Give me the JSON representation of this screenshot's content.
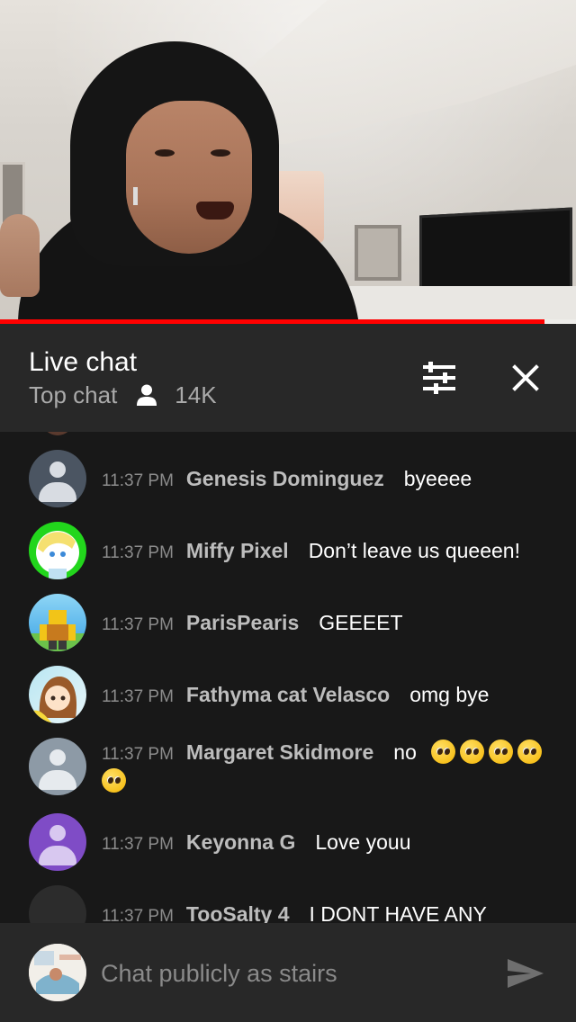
{
  "video": {
    "progress_fraction": 0.945
  },
  "chat": {
    "title": "Live chat",
    "mode": "Top chat",
    "viewer_count": "14K"
  },
  "messages": [
    {
      "time": "11:37 PM",
      "author": "Genesis Dominguez",
      "text": "byeeee",
      "avatar": "default-slate"
    },
    {
      "time": "11:37 PM",
      "author": "Miffy Pixel",
      "text": "Don’t leave us queeen!",
      "avatar": "green-anime"
    },
    {
      "time": "11:37 PM",
      "author": "ParisPearis",
      "text": "GEEEET",
      "avatar": "roblox-blue"
    },
    {
      "time": "11:37 PM",
      "author": "Fathyma cat Velasco",
      "text": "omg bye",
      "avatar": "anime-girl"
    },
    {
      "time": "11:37 PM",
      "author": "Margaret Skidmore",
      "text": "no",
      "emoji_count": 5,
      "emoji": "pleading-face-emoji",
      "avatar": "default-gray"
    },
    {
      "time": "11:37 PM",
      "author": "Keyonna G",
      "text": "Love youu",
      "avatar": "default-purple"
    },
    {
      "time": "11:37 PM",
      "author": "TooSalty 4",
      "text": "I DONT HAVE ANY",
      "avatar": "dark"
    }
  ],
  "input": {
    "placeholder": "Chat publicly as stairs"
  },
  "icons": {
    "filter": "sliders-icon",
    "close": "close-icon",
    "viewers": "person-icon",
    "send": "send-icon"
  },
  "colors": {
    "progress": "#ff0000",
    "header_bg": "#282828",
    "chat_bg": "#181818",
    "author": "#bdbdbd",
    "timestamp": "#8c8c8c"
  }
}
